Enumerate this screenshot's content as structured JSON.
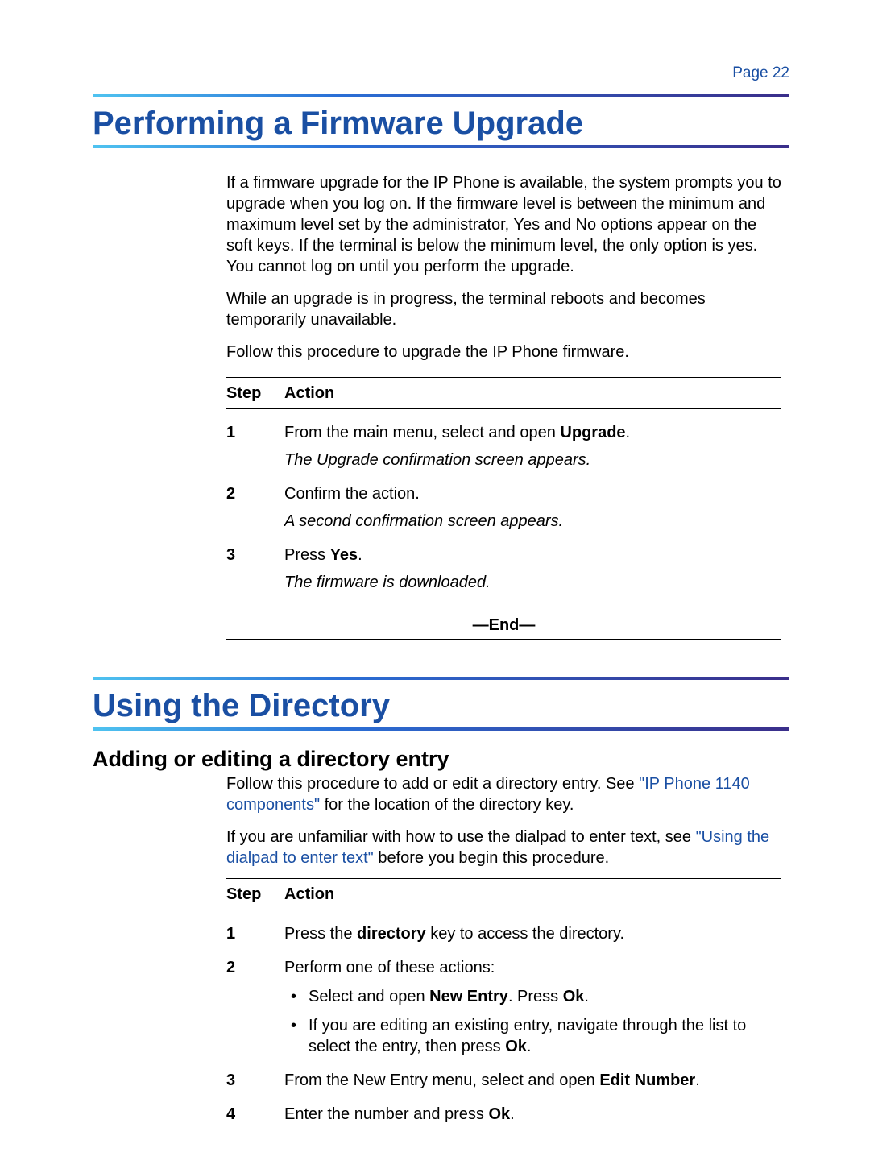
{
  "pageNumber": "Page 22",
  "section1": {
    "heading": "Performing a Firmware Upgrade",
    "p1": "If a firmware upgrade for the IP Phone is available, the system prompts you to upgrade when you log on. If the firmware level is between the minimum and maximum level set by the administrator, Yes and No options appear on the soft keys. If the terminal is below the minimum level, the only option is yes. You cannot log on until you perform the upgrade.",
    "p2": "While an upgrade is in progress, the terminal reboots and becomes temporarily unavailable.",
    "p3": "Follow this procedure to upgrade the IP Phone firmware.",
    "tableHeader": {
      "step": "Step",
      "action": "Action"
    },
    "steps": [
      {
        "n": "1",
        "action_pre": "From the main menu, select and open ",
        "action_bold": "Upgrade",
        "action_post": ".",
        "result": "The Upgrade confirmation screen appears."
      },
      {
        "n": "2",
        "action_pre": "Confirm the action.",
        "action_bold": "",
        "action_post": "",
        "result": "A second confirmation screen appears."
      },
      {
        "n": "3",
        "action_pre": "Press ",
        "action_bold": "Yes",
        "action_post": ".",
        "result": "The firmware is downloaded."
      }
    ],
    "end": "—End—"
  },
  "section2": {
    "heading": "Using the Directory",
    "subheading": "Adding or editing a directory entry",
    "p1_pre": "Follow this procedure to add or edit a directory entry. See ",
    "p1_link": "\"IP Phone 1140 components\"",
    "p1_post": " for the location of the directory key.",
    "p2_pre": "If you are unfamiliar with how to use the dialpad to enter text, see ",
    "p2_link": "\"Using the dialpad to enter text\"",
    "p2_post": " before you begin this procedure.",
    "tableHeader": {
      "step": "Step",
      "action": "Action"
    },
    "steps": {
      "s1": {
        "n": "1",
        "pre": "Press the ",
        "bold": "directory",
        "post": " key to access the directory."
      },
      "s2": {
        "n": "2",
        "intro": "Perform one of these actions:",
        "b1_pre": "Select and open ",
        "b1_bold1": "New Entry",
        "b1_mid": ". Press ",
        "b1_bold2": "Ok",
        "b1_post": ".",
        "b2_pre": "If you are editing an existing entry, navigate through the list to select the entry, then press ",
        "b2_bold": "Ok",
        "b2_post": "."
      },
      "s3": {
        "n": "3",
        "pre": "From the New Entry menu, select and open ",
        "bold": "Edit Number",
        "post": "."
      },
      "s4": {
        "n": "4",
        "pre": "Enter the number and press ",
        "bold": "Ok",
        "post": "."
      }
    }
  }
}
